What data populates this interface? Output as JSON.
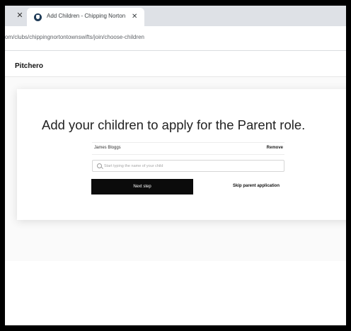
{
  "browser": {
    "tab_close_left": "✕",
    "tab_title": "Add Children - Chipping Norton",
    "tab_close": "✕",
    "url": "om/clubs/chippingnortontownswifts/join/choose-children"
  },
  "site": {
    "logo": "Pitchero"
  },
  "page": {
    "heading": "Add your children to apply for the Parent role.",
    "children": [
      {
        "name": "James Bloggs",
        "remove_label": "Remove"
      }
    ],
    "search": {
      "placeholder": "Start typing the name of your child",
      "value": ""
    },
    "next_label": "Next step",
    "skip_label": "Skip parent application"
  },
  "colors": {
    "primary_button": "#0b0b0b",
    "tabbar": "#dee1e6"
  }
}
